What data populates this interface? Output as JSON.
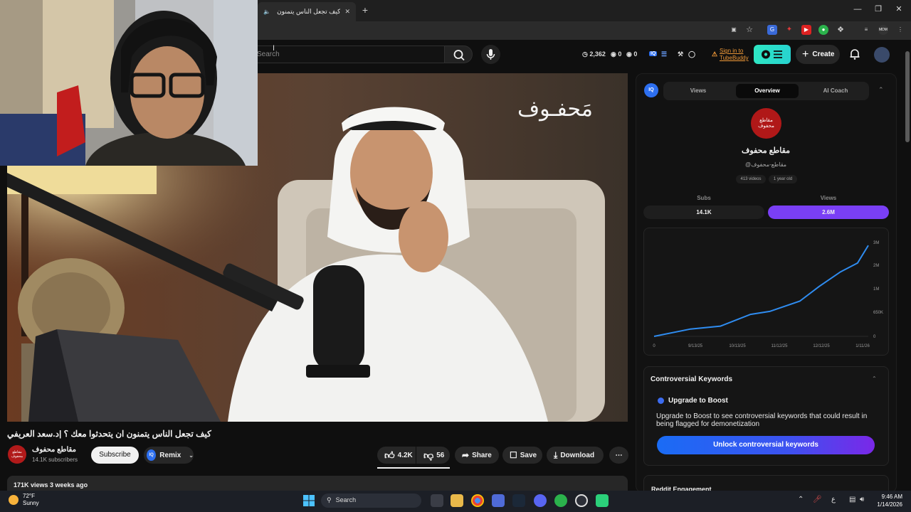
{
  "browser": {
    "tab_title": "كيف تجعل الناس يتمنون ان ي...",
    "new_tab_symbol": "+"
  },
  "youtube_header": {
    "search_placeholder": "Search",
    "stats": [
      {
        "icon": "clock-icon",
        "value": "2,362"
      },
      {
        "icon": "eye-icon",
        "value": "0"
      },
      {
        "icon": "eye-icon",
        "value": "0"
      }
    ],
    "signin_line1": "Sign in to",
    "signin_line2": "TubeBuddy",
    "create_label": "Create"
  },
  "video": {
    "overlay_logo_text": "مَحفـوف",
    "title": "كيف تجعل الناس يتمنون ان يتحدثوا معك ؟ |د.سعد العريفي",
    "channel": {
      "name": "مقاطع محفوف",
      "subscribers": "14.1K subscribers",
      "avatar_text": "مقاطع محفوف"
    },
    "subscribe_label": "Subscribe",
    "remix_label": "Remix",
    "actions": {
      "likes": "4.2K",
      "dislikes": "56",
      "share": "Share",
      "save": "Save",
      "download": "Download"
    },
    "description_meta": "171K views  3 weeks ago"
  },
  "panel": {
    "logo_text": "IQ",
    "tabs": [
      "Views",
      "Overview",
      "AI Coach"
    ],
    "active_tab": "Overview",
    "channel_logo_text": "مقاطع محفوف",
    "channel_name": "مقاطع محفوف",
    "channel_handle": "@مقاطع-محفوف",
    "chips": [
      "413 videos",
      "1 year old"
    ],
    "subs_label": "Subs",
    "subs_value": "14.1K",
    "views_label": "Views",
    "views_value": "2.6M",
    "accent": "#7a3ff5",
    "controversial_title": "Controversial Keywords",
    "upgrade_title": "Upgrade to Boost",
    "upgrade_desc": "Upgrade to Boost to see controversial keywords that could result in being flagged for demonetization",
    "unlock_label": "Unlock controversial keywords",
    "reddit_title": "Reddit Engagement"
  },
  "chart_data": {
    "type": "line",
    "title": "",
    "x": [
      "0",
      "9/13/25",
      "10/13/25",
      "11/12/25",
      "12/12/25",
      "1/11/26"
    ],
    "x_values": [
      0,
      0.17,
      0.31,
      0.45,
      0.54,
      0.68,
      0.77,
      0.87,
      0.95,
      1.0
    ],
    "series": [
      {
        "values": [
          0,
          0.25,
          0.35,
          0.75,
          0.85,
          1.2,
          1.7,
          2.2,
          2.5,
          3.1
        ]
      }
    ],
    "y_ticks": [
      "0",
      "650K",
      "1M",
      "2M",
      "3M"
    ],
    "ylim": [
      0,
      3.2
    ],
    "line_color": "#2f8cf0"
  },
  "taskbar": {
    "temp": "72°F",
    "condition": "Sunny",
    "search_label": "Search",
    "time": "9:46 AM",
    "date": "1/14/2026",
    "lang": "ع"
  }
}
